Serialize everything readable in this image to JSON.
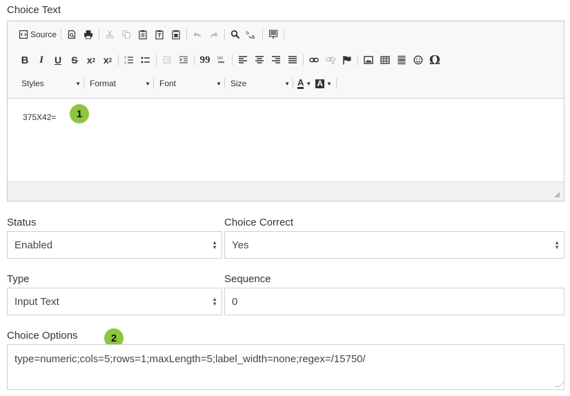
{
  "choice_text": {
    "label": "Choice Text",
    "content": "375X42=",
    "badge": "1"
  },
  "toolbar": {
    "source_label": "Source",
    "styles_label": "Styles",
    "format_label": "Format",
    "font_label": "Font",
    "size_label": "Size",
    "text_color_label": "A",
    "bg_color_label": "A",
    "omega": "Ω",
    "quote": "99"
  },
  "status": {
    "label": "Status",
    "value": "Enabled"
  },
  "choice_correct": {
    "label": "Choice Correct",
    "value": "Yes"
  },
  "type": {
    "label": "Type",
    "value": "Input Text"
  },
  "sequence": {
    "label": "Sequence",
    "value": "0"
  },
  "choice_options": {
    "label": "Choice Options",
    "value": "type=numeric;cols=5;rows=1;maxLength=5;label_width=none;regex=/15750/",
    "badge": "2"
  },
  "colors": {
    "badge_green": "#8cc63e",
    "border": "#cfcfcf",
    "toolbar_bg": "#f8f8f8"
  }
}
